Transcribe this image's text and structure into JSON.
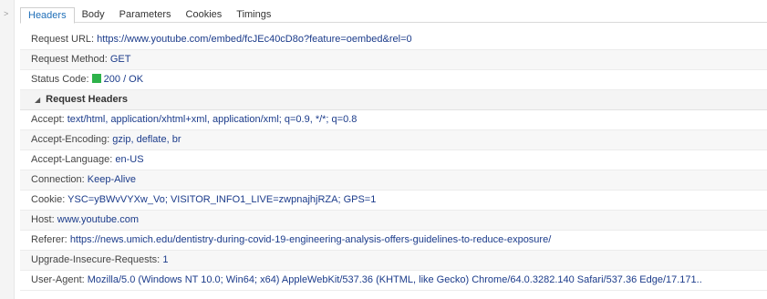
{
  "tabs": [
    "Headers",
    "Body",
    "Parameters",
    "Cookies",
    "Timings"
  ],
  "general": [
    {
      "key": "Request URL:",
      "value": "https://www.youtube.com/embed/fcJEc40cD8o?feature=oembed&rel=0"
    },
    {
      "key": "Request Method:",
      "value": "GET"
    },
    {
      "key": "Status Code:",
      "value": "200 / OK"
    }
  ],
  "status_color": "#2db24a",
  "section_title": "Request Headers",
  "headers": [
    {
      "key": "Accept:",
      "value": "text/html, application/xhtml+xml, application/xml; q=0.9, */*; q=0.8"
    },
    {
      "key": "Accept-Encoding:",
      "value": "gzip, deflate, br"
    },
    {
      "key": "Accept-Language:",
      "value": "en-US"
    },
    {
      "key": "Connection:",
      "value": "Keep-Alive"
    },
    {
      "key": "Cookie:",
      "value": "YSC=yBWvVYXw_Vo; VISITOR_INFO1_LIVE=zwpnajhjRZA; GPS=1"
    },
    {
      "key": "Host:",
      "value": "www.youtube.com"
    },
    {
      "key": "Referer:",
      "value": "https://news.umich.edu/dentistry-during-covid-19-engineering-analysis-offers-guidelines-to-reduce-exposure/"
    },
    {
      "key": "Upgrade-Insecure-Requests:",
      "value": "1"
    },
    {
      "key": "User-Agent:",
      "value": "Mozilla/5.0 (Windows NT 10.0; Win64; x64) AppleWebKit/537.36 (KHTML, like Gecko) Chrome/64.0.3282.140 Safari/537.36 Edge/17.171.."
    }
  ]
}
